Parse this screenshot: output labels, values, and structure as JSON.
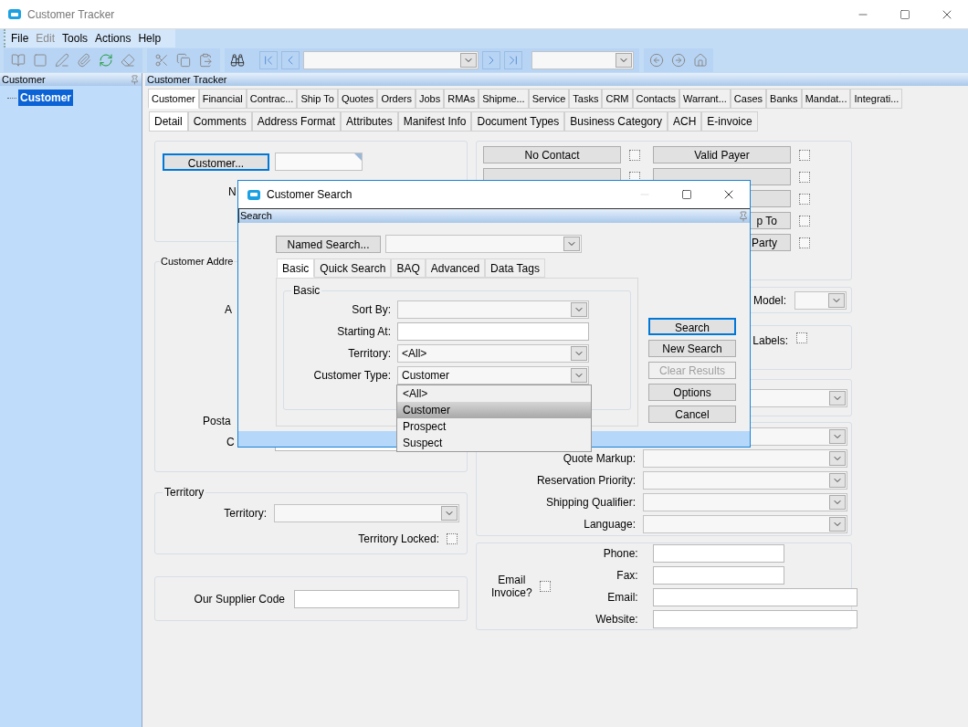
{
  "window": {
    "title": "Customer Tracker"
  },
  "menu": [
    {
      "label": "File",
      "disabled": false
    },
    {
      "label": "Edit",
      "disabled": true
    },
    {
      "label": "Tools",
      "disabled": false
    },
    {
      "label": "Actions",
      "disabled": false
    },
    {
      "label": "Help",
      "disabled": false
    }
  ],
  "tree_panel": {
    "title": "Customer",
    "items": [
      {
        "label": "Customer",
        "selected": true
      }
    ]
  },
  "main_panel": {
    "title": "Customer Tracker"
  },
  "tabs": [
    {
      "label": "Customer",
      "selected": true
    },
    {
      "label": "Financial",
      "selected": false
    },
    {
      "label": "Contrac...",
      "selected": false
    },
    {
      "label": "Ship To",
      "selected": false
    },
    {
      "label": "Quotes",
      "selected": false
    },
    {
      "label": "Orders",
      "selected": false
    },
    {
      "label": "Jobs",
      "selected": false
    },
    {
      "label": "RMAs",
      "selected": false
    },
    {
      "label": "Shipme...",
      "selected": false
    },
    {
      "label": "Service",
      "selected": false
    },
    {
      "label": "Tasks",
      "selected": false
    },
    {
      "label": "CRM",
      "selected": false
    },
    {
      "label": "Contacts",
      "selected": false
    },
    {
      "label": "Warrant...",
      "selected": false
    },
    {
      "label": "Cases",
      "selected": false
    },
    {
      "label": "Banks",
      "selected": false
    },
    {
      "label": "Mandat...",
      "selected": false
    },
    {
      "label": "Integrati...",
      "selected": false
    }
  ],
  "subtabs": [
    {
      "label": "Detail",
      "selected": true
    },
    {
      "label": "Comments",
      "selected": false
    },
    {
      "label": "Address Format",
      "selected": false
    },
    {
      "label": "Attributes",
      "selected": false
    },
    {
      "label": "Manifest Info",
      "selected": false
    },
    {
      "label": "Document Types",
      "selected": false
    },
    {
      "label": "Business Category",
      "selected": false
    },
    {
      "label": "ACH",
      "selected": false
    },
    {
      "label": "E-invoice",
      "selected": false
    }
  ],
  "customer_section": {
    "button": {
      "label": "Customer...",
      "focused": true
    },
    "label_fragment": "N"
  },
  "address_section": {
    "legend": "Customer Addre",
    "label_fragments": [
      "A",
      "Posta",
      "C"
    ]
  },
  "territory_section": {
    "legend": "Territory",
    "territory_label": "Territory:",
    "locked_label": "Territory Locked:",
    "locked_checked": false
  },
  "supplier_section": {
    "label": "Our Supplier Code"
  },
  "flags_left": [
    {
      "label": "No Contact",
      "checked": false
    },
    {
      "checked": false
    }
  ],
  "flags_right": [
    {
      "label": "Valid Payer",
      "checked": false
    },
    {
      "checked": false
    },
    {
      "checked": false
    },
    {
      "label": "p To",
      "checked": false
    },
    {
      "label": "Party",
      "checked": false
    }
  ],
  "model": {
    "label": "Model:"
  },
  "labels_option": {
    "label": "Labels:",
    "checked": false
  },
  "settings": [
    {
      "label": "Quote Markup:"
    },
    {
      "label": "Reservation Priority:"
    },
    {
      "label": "Shipping Qualifier:"
    },
    {
      "label": "Language:"
    }
  ],
  "contact": {
    "email_invoice_label": "Email Invoice?",
    "email_invoice_checked": false,
    "fields": [
      {
        "label": "Phone:",
        "kind": "short"
      },
      {
        "label": "Fax:",
        "kind": "short"
      },
      {
        "label": "Email:",
        "kind": "long"
      },
      {
        "label": "Website:",
        "kind": "long"
      }
    ]
  },
  "dialog": {
    "title": "Customer Search",
    "panel_title": "Search",
    "named_search_button": "Named Search...",
    "tabs": [
      {
        "label": "Basic",
        "selected": true
      },
      {
        "label": "Quick Search",
        "selected": false
      },
      {
        "label": "BAQ",
        "selected": false
      },
      {
        "label": "Advanced",
        "selected": false
      },
      {
        "label": "Data Tags",
        "selected": false
      }
    ],
    "group_legend": "Basic",
    "fields": [
      {
        "label": "Sort By:",
        "kind": "select"
      },
      {
        "label": "Starting At:",
        "kind": "text"
      },
      {
        "label": "Territory:",
        "kind": "select",
        "value": "<All>"
      },
      {
        "label": "Customer Type:",
        "kind": "select",
        "value": "Customer",
        "expanded": true
      }
    ],
    "buttons": [
      {
        "label": "Search",
        "focused": true,
        "disabled": false
      },
      {
        "label": "New Search",
        "focused": false,
        "disabled": false
      },
      {
        "label": "Clear Results",
        "focused": false,
        "disabled": true
      },
      {
        "label": "Options",
        "focused": false,
        "disabled": false
      },
      {
        "label": "Cancel",
        "focused": false,
        "disabled": false
      }
    ],
    "dropdown_options": [
      {
        "label": "<All>",
        "selected": false
      },
      {
        "label": "Customer",
        "selected": true
      },
      {
        "label": "Prospect",
        "selected": false
      },
      {
        "label": "Suspect",
        "selected": false
      }
    ]
  }
}
